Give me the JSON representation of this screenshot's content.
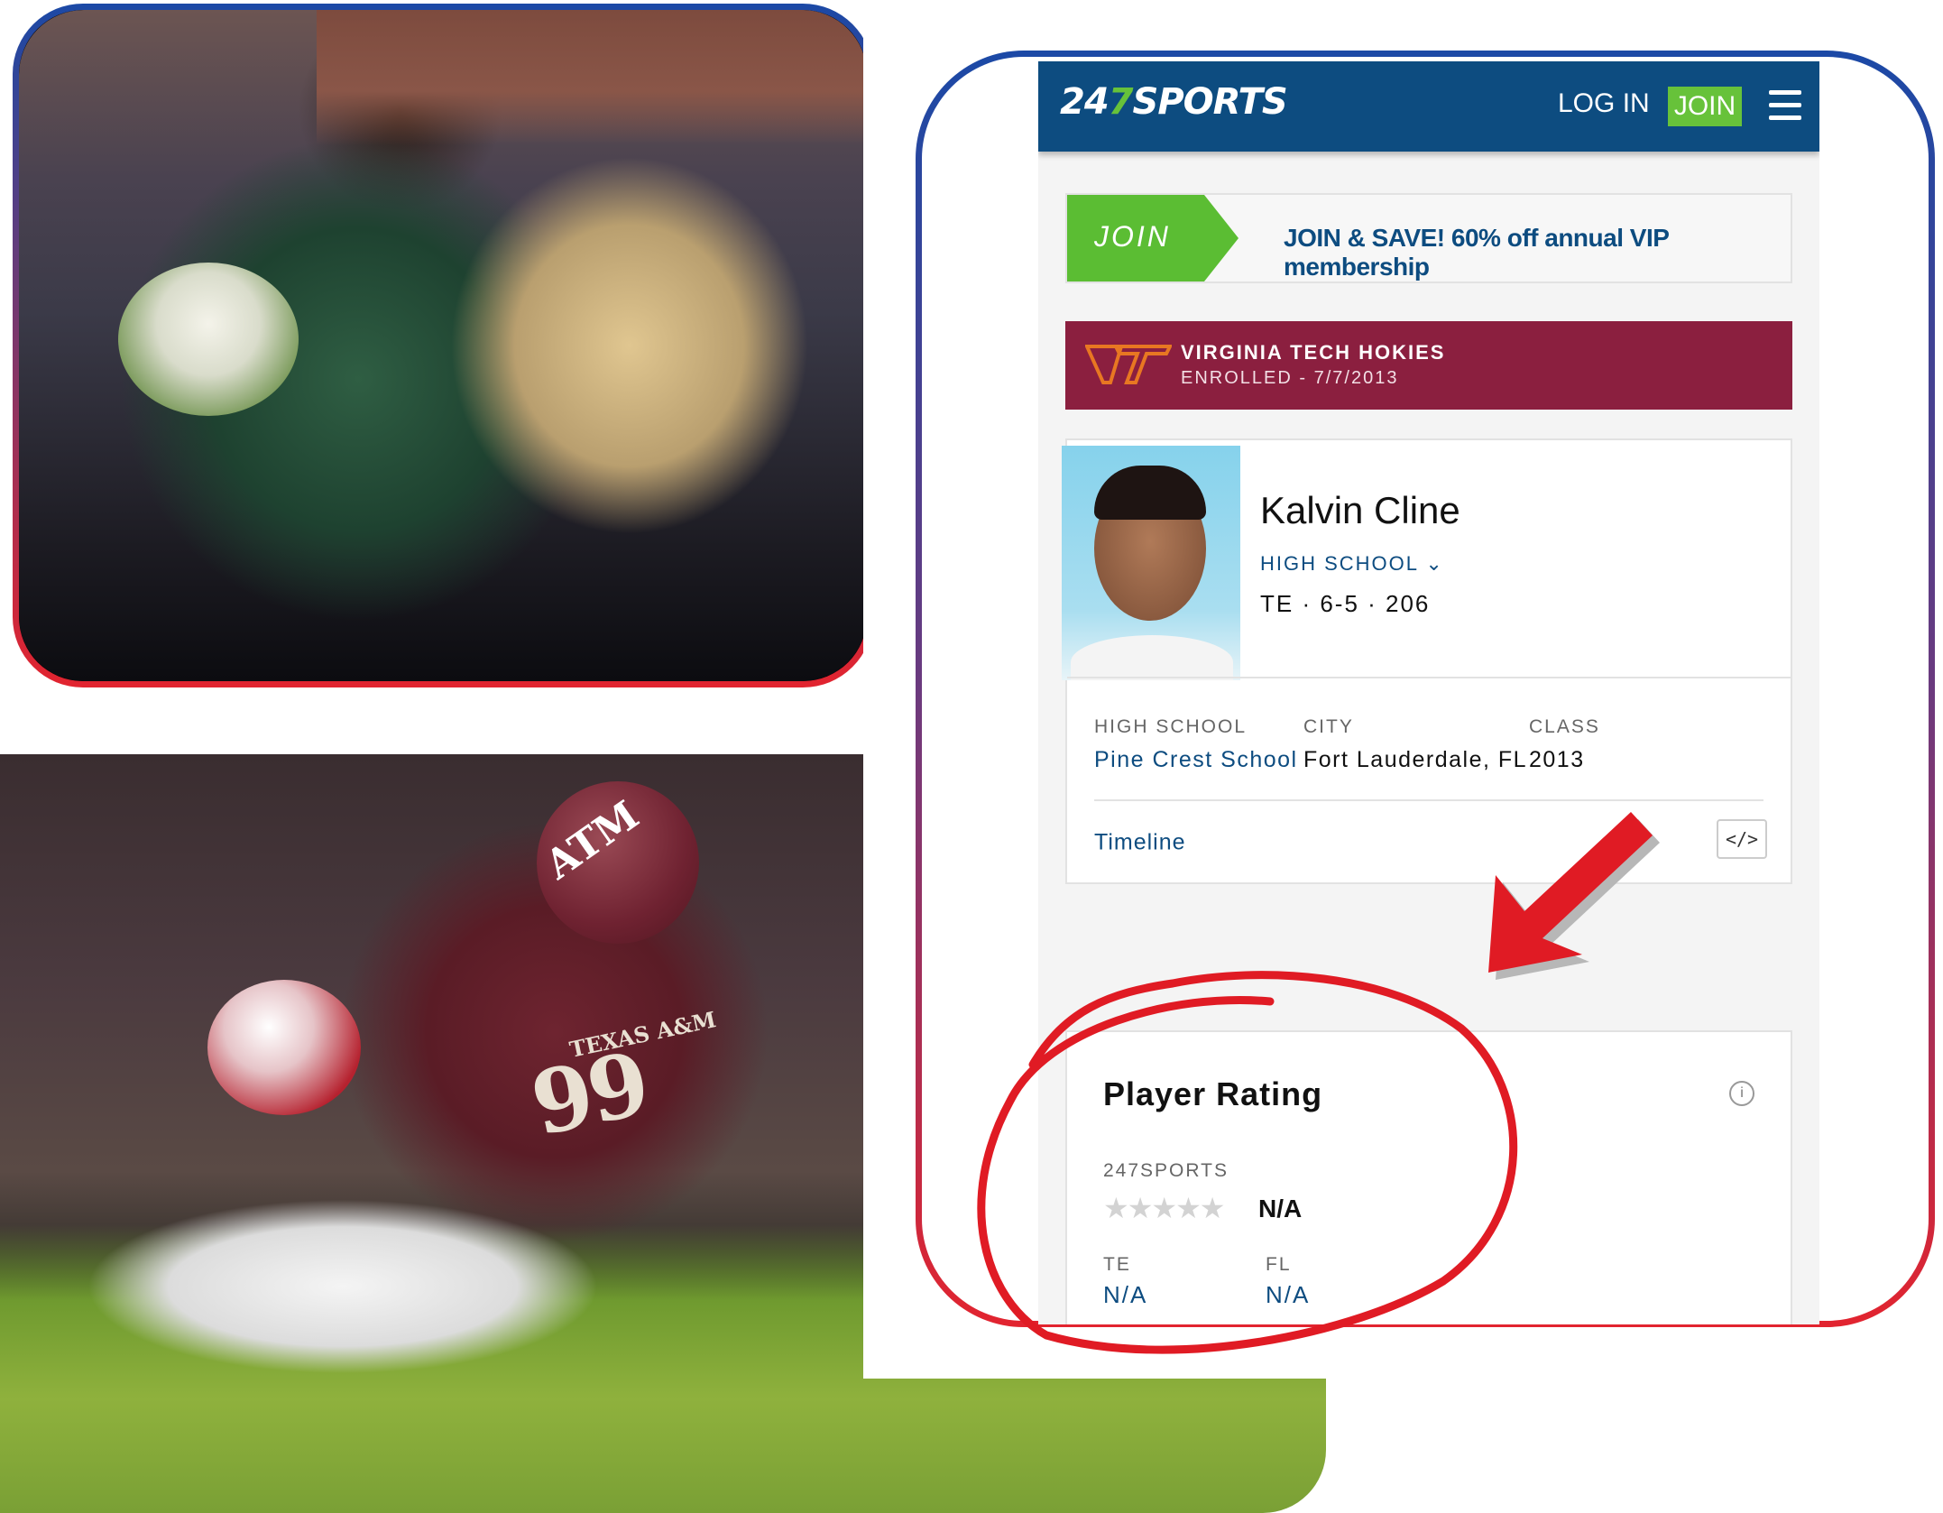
{
  "site": {
    "logo_prefix": "24",
    "logo_seven": "7",
    "logo_suffix": "SPORTS",
    "login_label": "LOG IN",
    "join_label": "JOIN",
    "brand_blue": "#0d4c80",
    "brand_green": "#67c23a"
  },
  "promo": {
    "tag": "JOIN",
    "text": "JOIN & SAVE! 60% off annual VIP membership"
  },
  "school_bar": {
    "logo_text": "VT",
    "name": "VIRGINIA TECH HOKIES",
    "status": "ENROLLED - 7/7/2013",
    "color": "#8b1f3f"
  },
  "player": {
    "name": "Kalvin Cline",
    "level_link": "HIGH SCHOOL",
    "meta": "TE · 6-5 · 206",
    "high_school_label": "HIGH SCHOOL",
    "high_school": "Pine Crest School",
    "city_label": "CITY",
    "city": "Fort Lauderdale, FL",
    "class_label": "CLASS",
    "class_year": "2013",
    "timeline_label": "Timeline",
    "embed_icon": "</>"
  },
  "rating": {
    "title": "Player Rating",
    "info_icon": "i",
    "source": "247SPORTS",
    "stars_filled": 0,
    "stars_total": 5,
    "value": "N/A",
    "position_label": "TE",
    "position_rank": "N/A",
    "state_label": "FL",
    "state_rank": "N/A"
  },
  "photos": {
    "tackle_helmet_logo": "ATM",
    "tackle_jersey_text": "TEXAS A&M",
    "tackle_jersey_number": "99"
  },
  "annotation_color": "#e01b24"
}
